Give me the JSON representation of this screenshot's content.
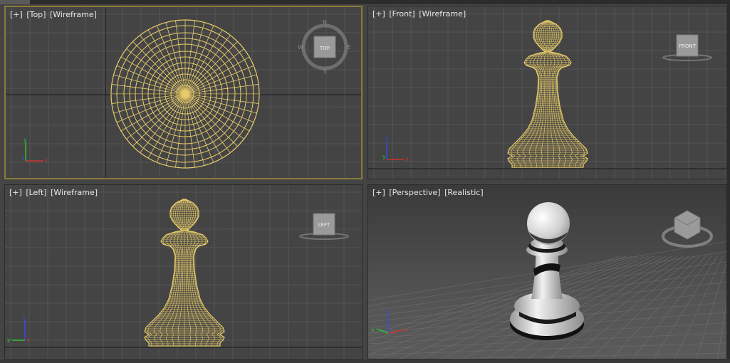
{
  "viewports": {
    "top": {
      "plus": "[+]",
      "view": "[Top]",
      "shading": "[Wireframe]",
      "cube_label": "TOP"
    },
    "front": {
      "plus": "[+]",
      "view": "[Front]",
      "shading": "[Wireframe]",
      "cube_label": "FRONT"
    },
    "left": {
      "plus": "[+]",
      "view": "[Left]",
      "shading": "[Wireframe]",
      "cube_label": "LEFT"
    },
    "persp": {
      "plus": "[+]",
      "view": "[Perspective]",
      "shading": "[Realistic]",
      "cube_label": ""
    }
  },
  "compass": {
    "n": "N",
    "s": "S",
    "e": "E",
    "w": "W"
  },
  "axes": {
    "x": "x",
    "y": "y",
    "z": "z"
  },
  "colors": {
    "viewport_bg": "#444444",
    "grid": "#555555",
    "grid_major": "#1a1a1a",
    "wire": "#e8cc6a",
    "active_border": "#8c7a3a",
    "axis_x": "#d03030",
    "axis_y": "#30c030",
    "axis_z": "#3050e0"
  }
}
